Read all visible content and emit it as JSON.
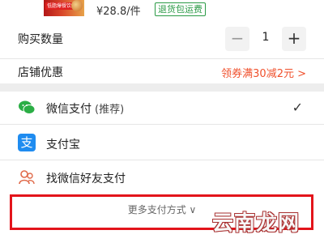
{
  "product": {
    "thumb_tag": "低脂爆餐饮健",
    "price": "¥28.8/件",
    "return_tag": "退货包运费"
  },
  "quantity": {
    "label": "购买数量",
    "minus": "−",
    "value": "1",
    "plus": "+"
  },
  "shop_discount": {
    "label": "店铺优惠",
    "value": "领券满30减2元 >"
  },
  "payment": {
    "wechat": {
      "label": "微信支付",
      "note": "(推荐)",
      "check": "✓"
    },
    "alipay": {
      "label": "支付宝",
      "icon_char": "支"
    },
    "friend": {
      "label": "找微信好友支付"
    }
  },
  "more_methods": "更多支付方式 ∨",
  "watermark": "云南龙网",
  "colors": {
    "accent_red": "#e3141b",
    "discount_orange": "#f0502c",
    "wechat_green": "#2bae45",
    "alipay_blue": "#1f8cf0",
    "return_green": "#2a9a45"
  }
}
